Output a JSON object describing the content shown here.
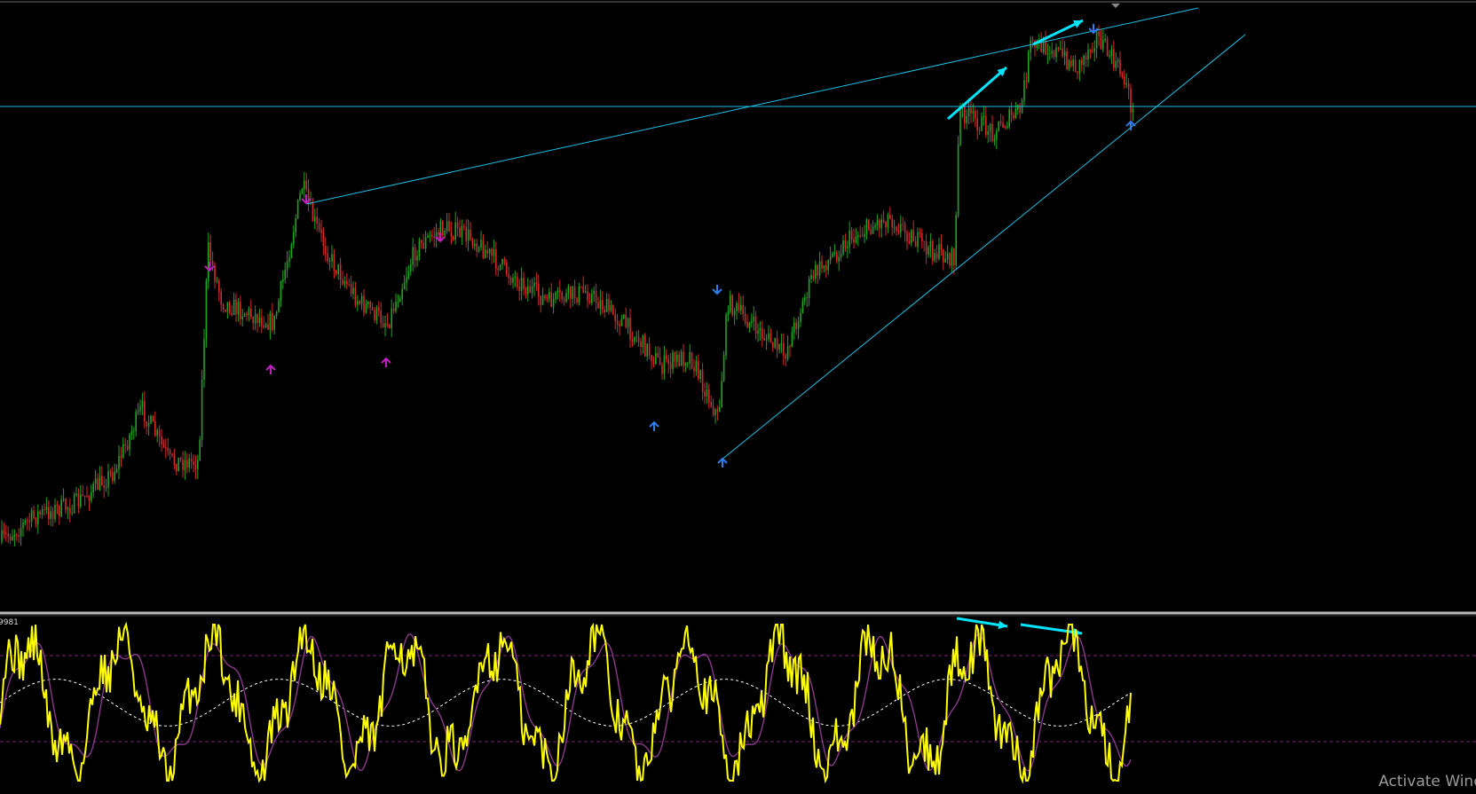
{
  "colors": {
    "background": "#000000",
    "bull_candle": "#1fa51f",
    "bear_candle": "#d42a2a",
    "trendline": "#1ec0e6",
    "arrow_annotation": "#00e5ff",
    "fractal_up": "#2d7ff0",
    "fractal_down": "#c01fc0",
    "oscillator_main": "#ffff00",
    "oscillator_signal": "#8a3a8a",
    "oscillator_baseline": "#ffffff",
    "level_line": "#7d1f7d",
    "separator": "#b9b9b9"
  },
  "indicator": {
    "value_label": "9981"
  },
  "watermark": {
    "text": "Activate Wind"
  },
  "chart_data": [
    {
      "type": "line",
      "description_source": "price",
      "x": [
        0,
        40,
        80,
        120,
        150,
        180,
        210,
        220,
        235,
        260,
        290,
        320,
        330,
        350,
        380,
        410,
        440,
        470,
        500,
        540,
        580,
        620,
        660,
        700,
        730,
        760,
        770,
        800,
        830,
        860,
        900,
        940,
        980,
        1010,
        1015,
        1050,
        1080,
        1090,
        1110,
        1140,
        1160,
        1190,
        1200
      ],
      "y": [
        0.05,
        0.1,
        0.12,
        0.18,
        0.3,
        0.2,
        0.2,
        0.6,
        0.5,
        0.48,
        0.46,
        0.72,
        0.66,
        0.58,
        0.5,
        0.46,
        0.6,
        0.64,
        0.62,
        0.55,
        0.5,
        0.52,
        0.46,
        0.38,
        0.4,
        0.28,
        0.5,
        0.45,
        0.4,
        0.55,
        0.62,
        0.66,
        0.6,
        0.58,
        0.86,
        0.82,
        0.86,
        0.98,
        0.98,
        0.94,
        1.0,
        0.92,
        0.84
      ],
      "annotations": [
        "ascending wedge trendlines",
        "horizontal resistance level",
        "fractal arrows"
      ],
      "grid": false
    },
    {
      "type": "line",
      "series": [
        {
          "role": "main",
          "color": "#ffff00"
        },
        {
          "role": "signal",
          "color": "#8a3a8a"
        }
      ],
      "levels": [
        "upper",
        "lower"
      ],
      "grid": false
    }
  ]
}
